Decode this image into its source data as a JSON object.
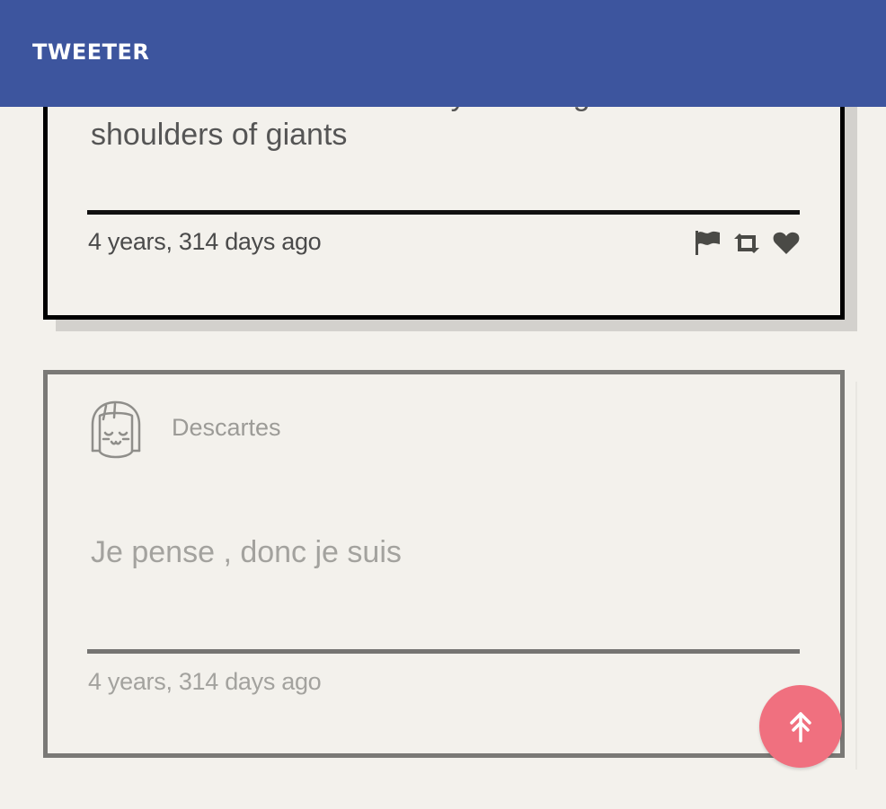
{
  "header": {
    "brand": "TWEETER"
  },
  "tweets": [
    {
      "text": "If I have seen further it is by standing on the shoulders of giants",
      "time": "4 years, 314 days ago",
      "actions": [
        "flag-icon",
        "retweet-icon",
        "heart-icon"
      ]
    },
    {
      "author": "Descartes",
      "avatar": "girl-face-avatar-icon",
      "text": "Je pense , donc je suis",
      "time": "4 years, 314 days ago"
    }
  ],
  "fab": {
    "icon": "double-arrow-up-icon"
  },
  "colors": {
    "header": "#3d559e",
    "background": "#f3f1ec",
    "fab": "#f0707f"
  }
}
